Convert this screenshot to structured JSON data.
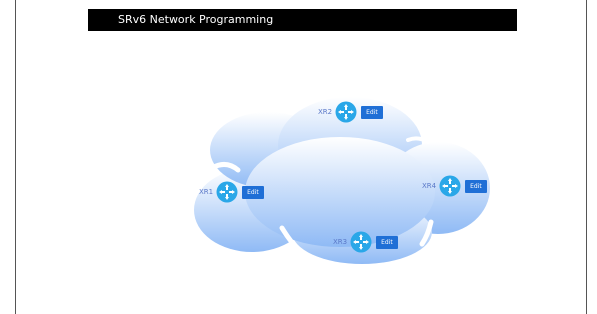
{
  "header": {
    "title": "SRv6 Network Programming"
  },
  "nodes": [
    {
      "label": "XR1",
      "edit_label": "Edit",
      "icon": "router-icon"
    },
    {
      "label": "XR2",
      "edit_label": "Edit",
      "icon": "router-icon"
    },
    {
      "label": "XR3",
      "edit_label": "Edit",
      "icon": "router-icon"
    },
    {
      "label": "XR4",
      "edit_label": "Edit",
      "icon": "router-icon"
    }
  ],
  "colors": {
    "cloud_top": "#ffffff",
    "cloud_bottom": "#8fbaf5",
    "router_fill": "#2aa7e8",
    "edit_button": "#1f6fd6",
    "node_label": "#5a78c8",
    "title_bar": "#000000"
  }
}
